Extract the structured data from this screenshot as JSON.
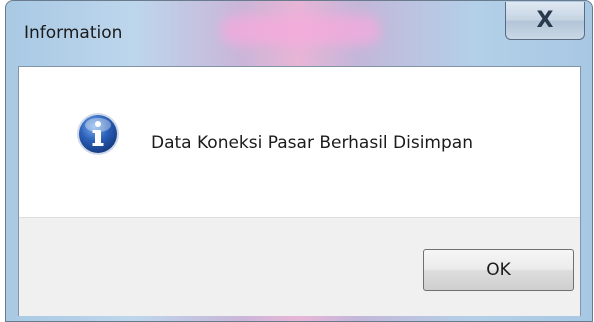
{
  "dialog": {
    "title": "Information",
    "message": "Data Koneksi Pasar Berhasil Disimpan",
    "ok_label": "OK",
    "close_label": "X",
    "icon": "info-icon"
  },
  "colors": {
    "info_icon": "#2a5fb8",
    "button_area": "#f0f0f0"
  }
}
